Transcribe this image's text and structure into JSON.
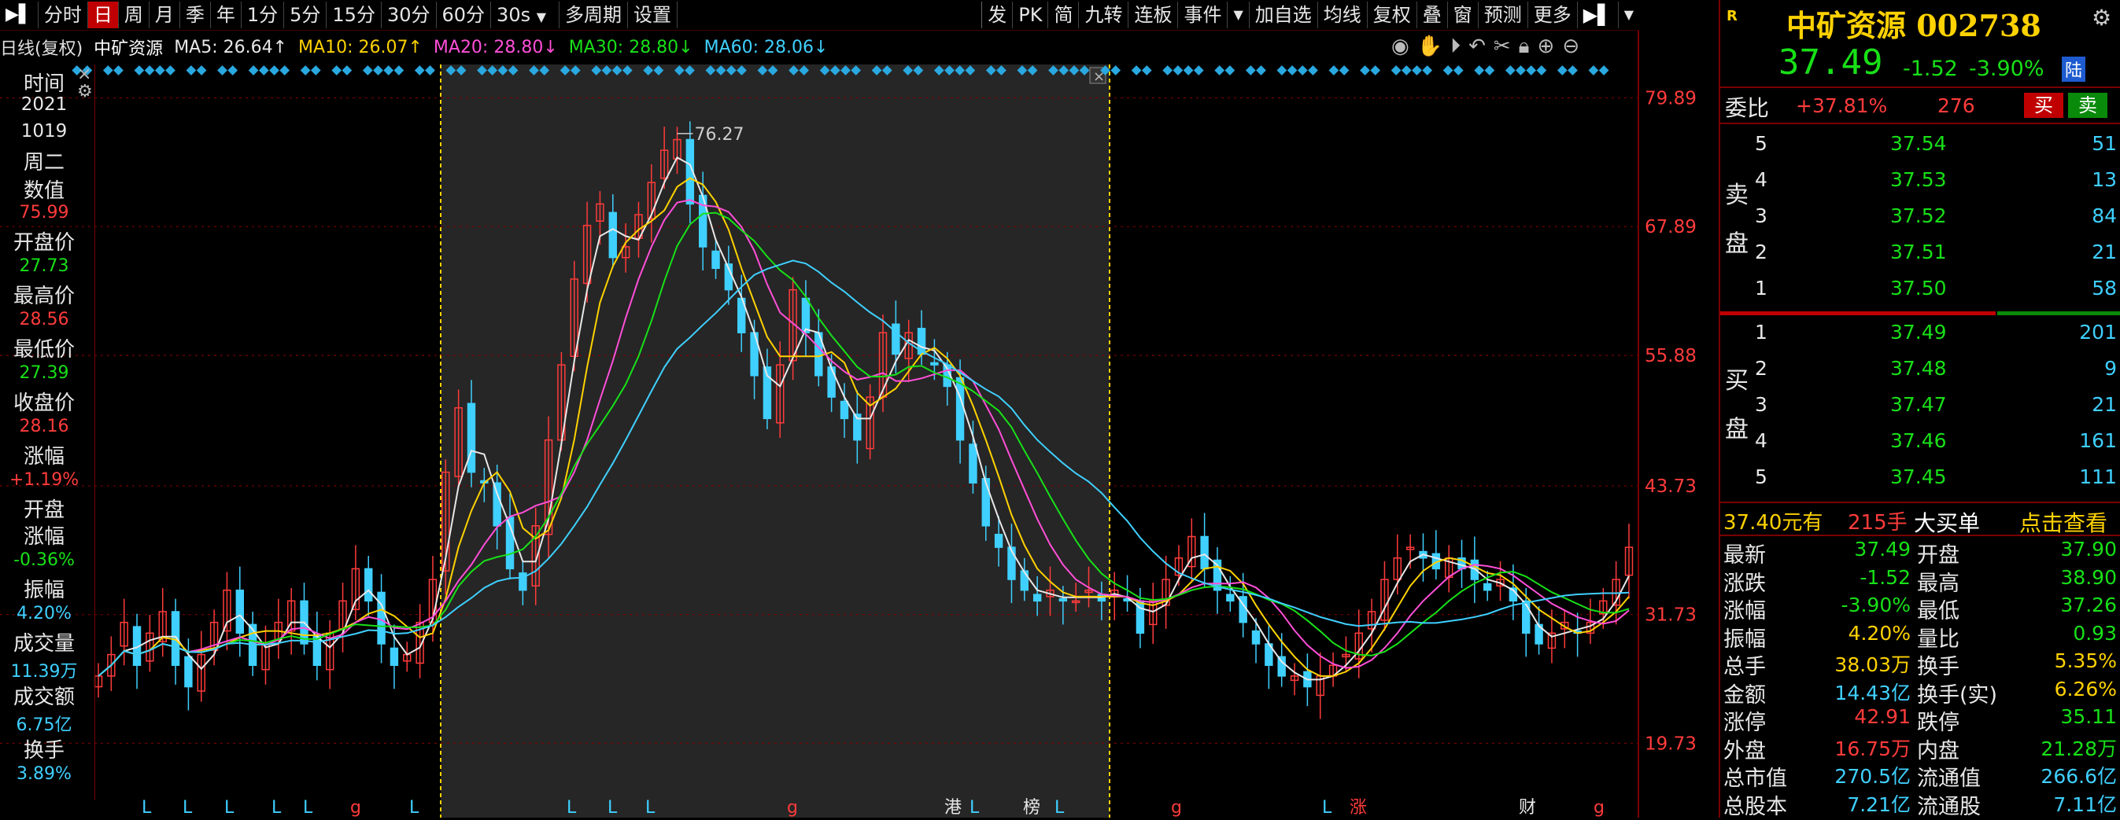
{
  "toolbar": {
    "left_items": [
      "分时",
      "日",
      "周",
      "月",
      "季",
      "年",
      "1分",
      "5分",
      "15分",
      "30分",
      "60分",
      "30s",
      "多周期",
      "设置"
    ],
    "active_index": 1,
    "right_items": [
      "发",
      "PK",
      "简",
      "九转",
      "连板",
      "事件",
      "加自选",
      "均线",
      "复权",
      "叠",
      "窗",
      "预测",
      "更多"
    ]
  },
  "legend": {
    "mode": "日线(复权)",
    "name": "中矿资源",
    "ma5": "MA5: 26.64↑",
    "ma10": "MA10: 26.07↑",
    "ma20": "MA20: 28.80↓",
    "ma30": "MA30: 28.80↓",
    "ma60": "MA60: 28.06↓"
  },
  "infocol": {
    "time_label": "时间",
    "year": "2021",
    "date": "1019",
    "weekday": "周二",
    "value_label": "数值",
    "value": "75.99",
    "open_label": "开盘价",
    "open": "27.73",
    "high_label": "最高价",
    "high": "28.56",
    "low_label": "最低价",
    "low": "27.39",
    "close_label": "收盘价",
    "close": "28.16",
    "chg_label": "涨幅",
    "chg": "+1.19%",
    "open_chg_label1": "开盘",
    "open_chg_label2": "涨幅",
    "open_chg": "-0.36%",
    "amp_label": "振幅",
    "amp": "4.20%",
    "vol_label": "成交量",
    "vol": "11.39万",
    "amt_label": "成交额",
    "amt": "6.75亿",
    "turn_label": "换手",
    "turn": "3.89%"
  },
  "axis": {
    "labels": [
      "79.89",
      "67.89",
      "55.88",
      "43.73",
      "31.73",
      "19.73"
    ],
    "peak_label": "76.27"
  },
  "bottom_markers": [
    "L",
    "L",
    "L",
    "L",
    "L",
    "g",
    "L",
    "L",
    "L",
    "L",
    "g",
    "港",
    "L",
    "榜",
    "L",
    "g",
    "L",
    "涨",
    "财",
    "g"
  ],
  "chart_data": {
    "type": "line",
    "y_ticks": [
      79.89,
      67.89,
      55.88,
      43.73,
      31.73,
      19.73
    ],
    "ylim": [
      15,
      83
    ],
    "peak": 76.27,
    "x": [
      0,
      1,
      2,
      3,
      4,
      5,
      6,
      7,
      8,
      9,
      10,
      11,
      12,
      13,
      14,
      15,
      16,
      17,
      18,
      19,
      20,
      21,
      22,
      23,
      24,
      25,
      26,
      27,
      28,
      29,
      30,
      31,
      32,
      33,
      34,
      35,
      36,
      37,
      38,
      39,
      40,
      41,
      42,
      43,
      44,
      45,
      46,
      47,
      48,
      49,
      50,
      51,
      52,
      53,
      54,
      55,
      56,
      57,
      58,
      59,
      60,
      61,
      62,
      63,
      64,
      65,
      66,
      67,
      68,
      69,
      70,
      71,
      72,
      73,
      74,
      75,
      76,
      77,
      78,
      79,
      80,
      81,
      82,
      83,
      84,
      85,
      86,
      87,
      88,
      89,
      90,
      91,
      92,
      93,
      94,
      95,
      96,
      97,
      98,
      99,
      100,
      101,
      102,
      103,
      104,
      105,
      106,
      107,
      108,
      109,
      110,
      111,
      112,
      113,
      114,
      115,
      116,
      117,
      118,
      119
    ],
    "series": [
      {
        "values": [
          26,
          28,
          31,
          27,
          30,
          32,
          27,
          25,
          28,
          31,
          34,
          30,
          27,
          29,
          31,
          33,
          29,
          27,
          30,
          33,
          36,
          33,
          29,
          27,
          28,
          31,
          35,
          45,
          51,
          45,
          44,
          40,
          36,
          34,
          40,
          48,
          55,
          63,
          68,
          70,
          65,
          66,
          69,
          72,
          75,
          76,
          70,
          66,
          64,
          62,
          58,
          54,
          50,
          55,
          62,
          58,
          54,
          52,
          50,
          48,
          52,
          58,
          56,
          58,
          56,
          55,
          53,
          48,
          44,
          40,
          38,
          35,
          34,
          33,
          34,
          33,
          33,
          34,
          33,
          34,
          33,
          30,
          33,
          35,
          37,
          39,
          36,
          34,
          33,
          31,
          29,
          27,
          26,
          26,
          25,
          26,
          27,
          28,
          30,
          32,
          35,
          37,
          38,
          37,
          36,
          37,
          36,
          35,
          34,
          35,
          33,
          30,
          29,
          30,
          31,
          30,
          31,
          33,
          35,
          38
        ]
      }
    ]
  },
  "rightpanel": {
    "badge": "R",
    "title": "中矿资源 002738",
    "price": "37.49",
    "change": "-1.52",
    "pct": "-3.90%",
    "lu": "陆",
    "weibi_label": "委比",
    "weibi": "+37.81%",
    "weicha": "276",
    "buy_btn": "买",
    "sell_btn": "卖",
    "sell_label": "卖盘",
    "buy_label": "买盘",
    "sell_book": [
      {
        "lvl": "5",
        "price": "37.54",
        "vol": "51"
      },
      {
        "lvl": "4",
        "price": "37.53",
        "vol": "13"
      },
      {
        "lvl": "3",
        "price": "37.52",
        "vol": "84"
      },
      {
        "lvl": "2",
        "price": "37.51",
        "vol": "21"
      },
      {
        "lvl": "1",
        "price": "37.50",
        "vol": "58"
      }
    ],
    "buy_book": [
      {
        "lvl": "1",
        "price": "37.49",
        "vol": "201"
      },
      {
        "lvl": "2",
        "price": "37.48",
        "vol": "9"
      },
      {
        "lvl": "3",
        "price": "37.47",
        "vol": "21"
      },
      {
        "lvl": "4",
        "price": "37.46",
        "vol": "161"
      },
      {
        "lvl": "5",
        "price": "37.45",
        "vol": "111"
      }
    ],
    "bigbuy_price": "37.40元有",
    "bigbuy_vol": "215手",
    "bigbuy_label": "大买单",
    "bigbuy_link": "点击查看",
    "stats": [
      {
        "l1": "最新",
        "v1": "37.49",
        "c1": "green",
        "l2": "开盘",
        "v2": "37.90",
        "c2": "green"
      },
      {
        "l1": "涨跌",
        "v1": "-1.52",
        "c1": "green",
        "l2": "最高",
        "v2": "38.90",
        "c2": "green"
      },
      {
        "l1": "涨幅",
        "v1": "-3.90%",
        "c1": "green",
        "l2": "最低",
        "v2": "37.26",
        "c2": "green"
      },
      {
        "l1": "振幅",
        "v1": "4.20%",
        "c1": "yellow",
        "l2": "量比",
        "v2": "0.93",
        "c2": "green"
      },
      {
        "l1": "总手",
        "v1": "38.03万",
        "c1": "yellow",
        "l2": "换手",
        "v2": "5.35%",
        "c2": "yellow"
      },
      {
        "l1": "金额",
        "v1": "14.43亿",
        "c1": "cyan",
        "l2": "换手(实)",
        "v2": "6.26%",
        "c2": "yellow"
      },
      {
        "l1": "涨停",
        "v1": "42.91",
        "c1": "red",
        "l2": "跌停",
        "v2": "35.11",
        "c2": "green"
      },
      {
        "l1": "外盘",
        "v1": "16.75万",
        "c1": "red",
        "l2": "内盘",
        "v2": "21.28万",
        "c2": "green"
      },
      {
        "l1": "总市值",
        "v1": "270.5亿",
        "c1": "cyan",
        "l2": "流通值",
        "v2": "266.6亿",
        "c2": "cyan"
      },
      {
        "l1": "总股本",
        "v1": "7.21亿",
        "c1": "cyan",
        "l2": "流通股",
        "v2": "7.11亿",
        "c2": "cyan"
      }
    ]
  },
  "colors": {
    "up": "#ff3b3b",
    "down": "#18e018",
    "ma5": "#e8e8e8",
    "ma10": "#ffd200",
    "ma20": "#ff4fd8",
    "ma30": "#18e018",
    "ma60": "#3fd0ff",
    "grid": "#7a0000"
  }
}
